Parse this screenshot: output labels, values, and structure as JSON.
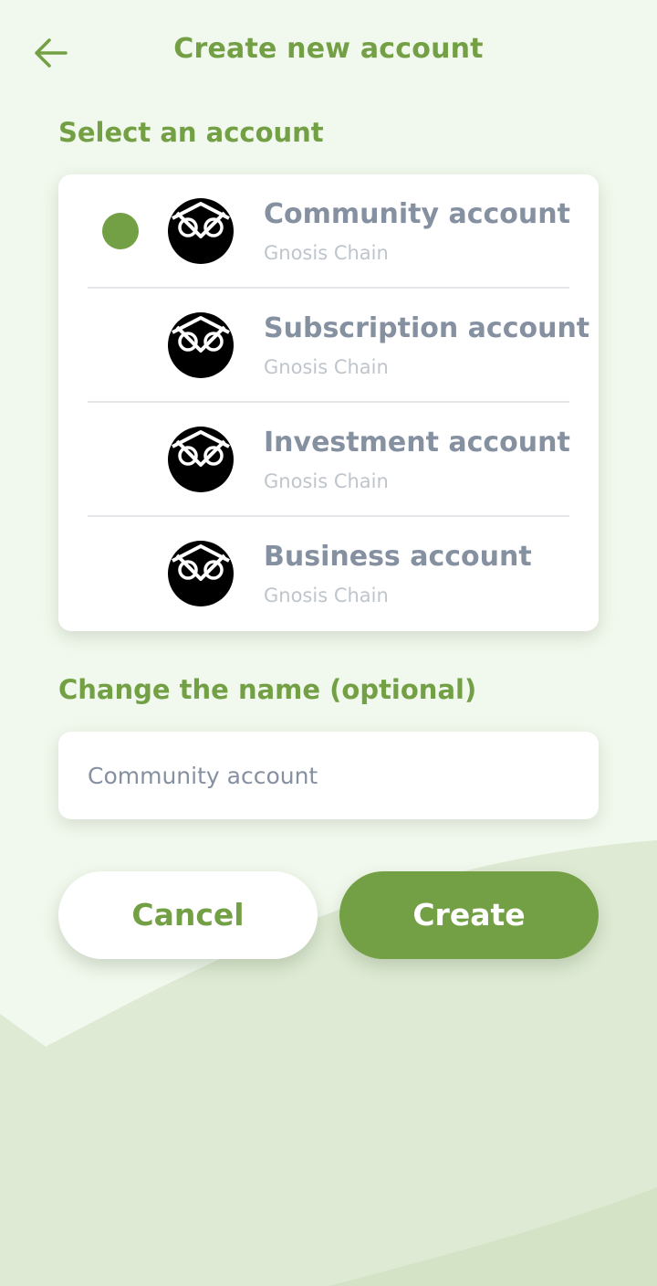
{
  "header": {
    "title": "Create new account",
    "back_icon": "arrow-left-icon"
  },
  "select_section": {
    "label": "Select an account",
    "selected_index": 0,
    "accounts": [
      {
        "name": "Community account",
        "chain": "Gnosis Chain",
        "icon": "gnosis-owl-logo-icon",
        "selected": true
      },
      {
        "name": "Subscription account",
        "chain": "Gnosis Chain",
        "icon": "gnosis-owl-logo-icon",
        "selected": false
      },
      {
        "name": "Investment account",
        "chain": "Gnosis Chain",
        "icon": "gnosis-owl-logo-icon",
        "selected": false
      },
      {
        "name": "Business account",
        "chain": "Gnosis Chain",
        "icon": "gnosis-owl-logo-icon",
        "selected": false
      }
    ]
  },
  "name_section": {
    "label": "Change the name (optional)",
    "value": "Community account"
  },
  "actions": {
    "cancel_label": "Cancel",
    "create_label": "Create"
  },
  "colors": {
    "accent": "#73a044",
    "background": "#f1f8ed",
    "muted_text": "#8590a0",
    "subtle_text": "#bfc5cd"
  }
}
